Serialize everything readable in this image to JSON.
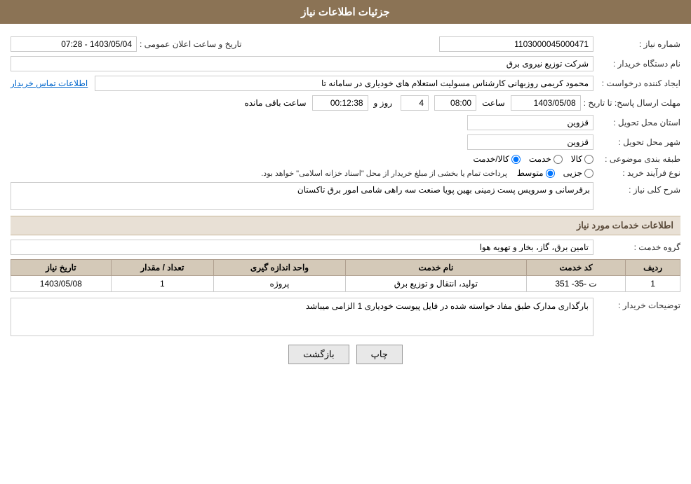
{
  "header": {
    "title": "جزئیات اطلاعات نیاز"
  },
  "fields": {
    "shomareNiaz_label": "شماره نیاز :",
    "shomareNiaz_value": "1103000045000471",
    "namDastgah_label": "نام دستگاه خریدار :",
    "namDastgah_value": "شرکت توزیع نیروی برق",
    "ijadKonande_label": "ایجاد کننده درخواست :",
    "ijadKonande_value": "محمود کریمی روزبهانی کارشناس  مسولیت استعلام های خودیاری در سامانه تا",
    "ettelaatTamas_text": "اطلاعات تماس خریدار",
    "mohlatErsal_label": "مهلت ارسال پاسخ: تا تاریخ :",
    "mohlatErsal_date": "1403/05/08",
    "mohlatErsal_saat_label": "ساعت",
    "mohlatErsal_saat_value": "08:00",
    "mohlatErsal_roz_label": "روز و",
    "mohlatErsal_roz_value": "4",
    "mohlatErsal_remaining_label": "ساعت باقی مانده",
    "mohlatErsal_remaining_value": "00:12:38",
    "tarikh_label": "تاریخ و ساعت اعلان عمومی :",
    "tarikh_value": "1403/05/04 - 07:28",
    "ostan_label": "استان محل تحویل :",
    "ostan_value": "قزوین",
    "shahr_label": "شهر محل تحویل :",
    "shahr_value": "قزوین",
    "tabaqe_label": "طبقه بندی موضوعی :",
    "tabaqe_kala": "کالا",
    "tabaqe_khedmat": "خدمت",
    "tabaqe_kala_khedmat": "کالا/خدمت",
    "noeFarayand_label": "نوع فرآیند خرید :",
    "noeFarayand_jazei": "جزیی",
    "noeFarayand_motavasset": "متوسط",
    "noeFarayand_desc": "پرداخت تمام یا بخشی از مبلغ خریدار از محل \"اسناد خزانه اسلامی\" خواهد بود.",
    "sharh_label": "شرح کلی نیاز :",
    "sharh_value": "برقرسانی و سرویس پست زمینی بهین پویا صنعت سه راهی شامی امور برق تاکستان",
    "info_khadamat_title": "اطلاعات خدمات مورد نیاز",
    "grohe_khedmat_label": "گروه خدمت :",
    "grohe_khedmat_value": "تامین برق، گاز، بخار و تهویه هوا",
    "table": {
      "headers": [
        "ردیف",
        "کد خدمت",
        "نام خدمت",
        "واحد اندازه گیری",
        "تعداد / مقدار",
        "تاریخ نیاز"
      ],
      "rows": [
        {
          "radif": "1",
          "kodKhedmat": "ت -35- 351",
          "namKhedmat": "تولید، انتقال و توزیع برق",
          "vahed": "پروژه",
          "tedad": "1",
          "tarikh": "1403/05/08"
        }
      ]
    },
    "tosihaat_label": "توضیحات خریدار :",
    "tosihaat_value": "بارگذاری مدارک طبق مفاد خواسته شده در فایل پیوست خودیاری 1 الزامی میباشد"
  },
  "buttons": {
    "print_label": "چاپ",
    "back_label": "بازگشت"
  }
}
